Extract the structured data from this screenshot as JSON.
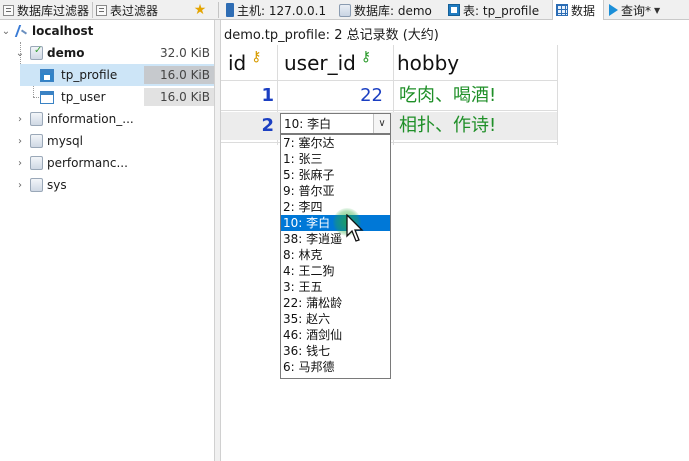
{
  "toolbar": {
    "db_filter_label": "数据库过滤器",
    "table_filter_label": "表过滤器",
    "host_label": "主机: 127.0.0.1",
    "database_label": "数据库: demo",
    "table_label": "表: tp_profile",
    "data_label": "数据",
    "query_label": "查询*"
  },
  "tree": {
    "host": "localhost",
    "database": {
      "name": "demo",
      "size": "32.0 KiB"
    },
    "tables": [
      {
        "name": "tp_profile",
        "size": "16.0 KiB",
        "selected": true
      },
      {
        "name": "tp_user",
        "size": "16.0 KiB",
        "selected": false
      }
    ],
    "other_databases": [
      "information_...",
      "mysql",
      "performanc...",
      "sys"
    ]
  },
  "data": {
    "record_info": "demo.tp_profile: 2 总记录数 (大约)",
    "columns": [
      {
        "name": "id",
        "key": "primary"
      },
      {
        "name": "user_id",
        "key": "foreign"
      },
      {
        "name": "hobby",
        "key": "none"
      }
    ],
    "rows": [
      {
        "id": "1",
        "user_id": "22",
        "hobby": "吃肉、喝酒!"
      },
      {
        "id": "2",
        "user_id": "10: 李白",
        "hobby": "相扑、作诗!"
      }
    ],
    "combo": {
      "value": "10: 李白",
      "options": [
        "7: 塞尔达",
        "1: 张三",
        "5: 张麻子",
        "9: 普尔亚",
        "2: 李四",
        "10: 李白",
        "38: 李逍遥",
        "8: 林克",
        "4: 王二狗",
        "3: 王五",
        "22: 蒲松龄",
        "35: 赵六",
        "46: 酒剑仙",
        "36: 钱七",
        "6: 马邦德"
      ],
      "highlighted_index": 5
    }
  },
  "colors": {
    "selection_blue": "#0078d7",
    "number_blue": "#1b3fc2",
    "text_green": "#1f8f28",
    "row_selected": "#ececec"
  }
}
